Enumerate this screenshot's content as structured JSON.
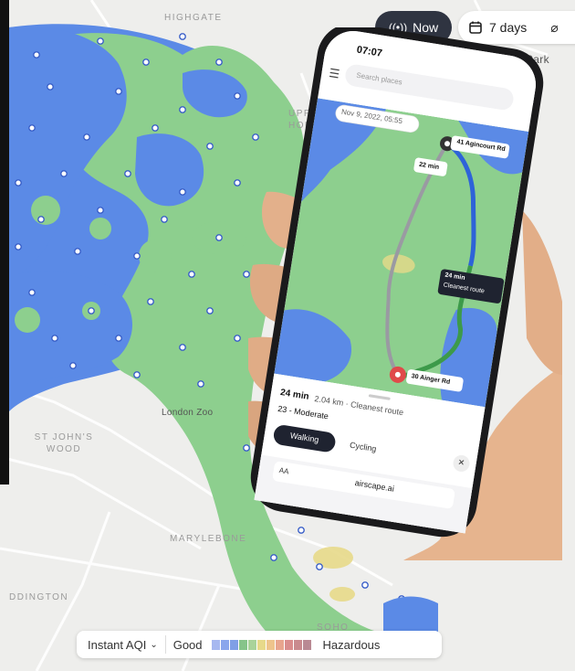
{
  "map": {
    "labels": {
      "highgate": "HIGHGATE",
      "upper_holloway": "UPPER HOLLOWAY",
      "st_johns_wood": "ST JOHN'S WOOD",
      "london_zoo": "London Zoo",
      "marylebone": "MARYLEBONE",
      "paddington": "DDINGTON",
      "soho": "SOHO",
      "park": "Park"
    }
  },
  "toolbar": {
    "now_label": "Now",
    "days_label": "7 days"
  },
  "phone": {
    "time": "07:07",
    "search_placeholder": "Search places",
    "date_chip": "Nov 9, 2022, 05:55",
    "origin": "41 Agincourt Rd",
    "destination": "30 Ainger Rd",
    "route_time_1": "22 min",
    "route_time_2": "24 min",
    "route_caption": "Cleanest route",
    "summary_time": "24 min",
    "summary_detail": "2.04 km · Cleanest route",
    "aqi_line": "23 - Moderate",
    "mode_walking": "Walking",
    "mode_cycling": "Cycling",
    "url": "airscape.ai",
    "aa": "AA"
  },
  "legend": {
    "selector": "Instant AQI",
    "good": "Good",
    "hazardous": "Hazardous",
    "colors": [
      "#a7b8f0",
      "#8aa6ec",
      "#7f9fe6",
      "#86c48a",
      "#a9d39a",
      "#e7d98a",
      "#eec48c",
      "#e8a58e",
      "#d98d8d",
      "#c98a8e",
      "#b98993"
    ]
  },
  "colors": {
    "water_blue": "#5b8ae6",
    "park_green": "#8dcf8e",
    "pill_dark": "#2f3441",
    "route_blue": "#2e63d8",
    "route_green": "#3d9a4a"
  }
}
